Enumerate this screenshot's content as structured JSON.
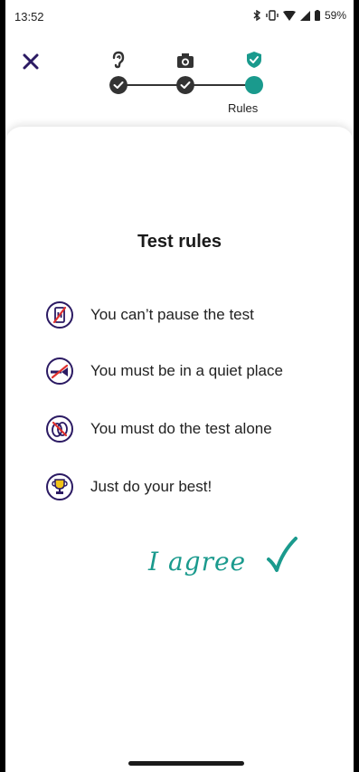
{
  "status_bar": {
    "time": "13:52",
    "battery": "59%"
  },
  "header": {
    "close_icon": "close-icon",
    "steps": [
      {
        "icon": "ear-icon",
        "state": "done"
      },
      {
        "icon": "camera-icon",
        "state": "done"
      },
      {
        "icon": "shield-check-icon",
        "state": "current",
        "label": "Rules"
      }
    ]
  },
  "content": {
    "title": "Test rules",
    "rules": [
      {
        "icon": "no-pause-icon",
        "text": "You can’t pause the test"
      },
      {
        "icon": "no-trumpet-icon",
        "text": "You must be in a quiet place"
      },
      {
        "icon": "no-people-icon",
        "text": "You must do the test alone"
      },
      {
        "icon": "trophy-icon",
        "text": "Just do your best!"
      }
    ],
    "agree_label": "I agree"
  },
  "colors": {
    "accent": "#1a9a8d",
    "navy": "#2b1a63",
    "red": "#e0302e"
  }
}
